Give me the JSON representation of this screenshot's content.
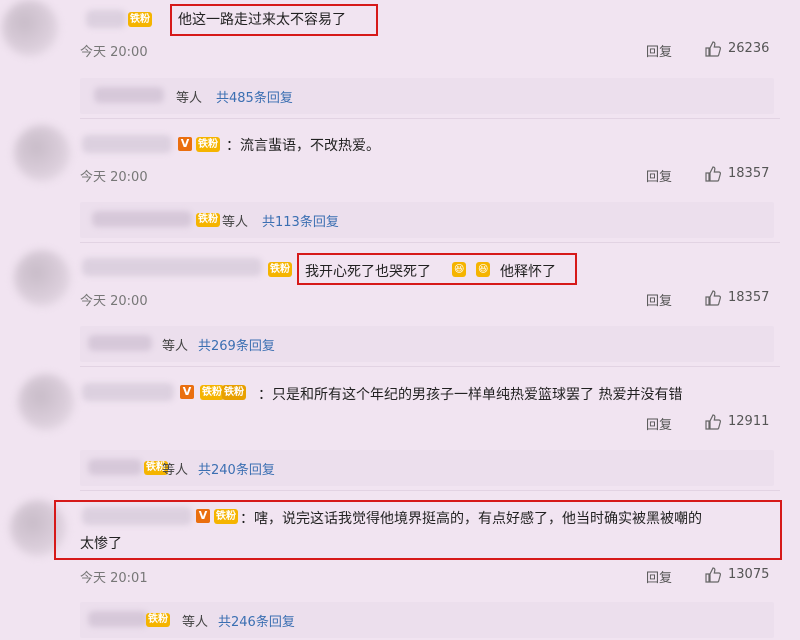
{
  "comments": [
    {
      "text": "他这一路走过来太不容易了",
      "time": "今天 20:00",
      "reply": "回复",
      "likes": "26236",
      "badge": "铁粉"
    },
    {
      "text": "：流言蜚语，不改热爱。",
      "time": "今天 20:00",
      "reply": "回复",
      "likes": "18357",
      "badge": "铁粉"
    },
    {
      "text_a": "我开心死了也哭死了",
      "text_b": "他释怀了",
      "time": "今天 20:00",
      "reply": "回复",
      "likes": "18357"
    },
    {
      "text": "：只是和所有这个年纪的男孩子一样单纯热爱篮球罢了 热爱并没有错",
      "time": "",
      "reply": "回复",
      "likes": "12911",
      "badge": "铁粉"
    },
    {
      "line1": "：嗐，说完这话我觉得他境界挺高的，有点好感了，他当时确实被黑被嘲的",
      "line2": "太惨了",
      "time": "今天 20:01",
      "reply": "回复",
      "likes": "13075"
    }
  ],
  "subreplies": [
    {
      "who": "等人",
      "more": "共485条回复"
    },
    {
      "who": "等人",
      "more": "共113条回复"
    },
    {
      "who": "等人",
      "more": "共269条回复"
    },
    {
      "who": "等人",
      "more": "共240条回复"
    },
    {
      "who": "等人",
      "more": "共246条回复"
    }
  ],
  "icons": {
    "like": "thumbs-up-icon",
    "vip": "v-verified-icon"
  },
  "colors": {
    "highlight": "#d61919",
    "link": "#3b6fb2",
    "badge": "#f5b400"
  }
}
